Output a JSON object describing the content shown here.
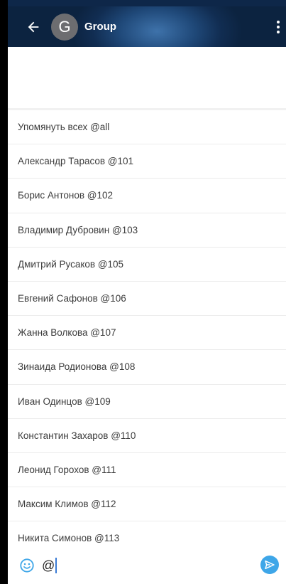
{
  "header": {
    "avatar_letter": "G",
    "title": "Group"
  },
  "mentions": [
    {
      "label": "Упомянуть всех @all"
    },
    {
      "label": "Александр Тарасов @101"
    },
    {
      "label": "Борис Антонов @102"
    },
    {
      "label": "Владимир Дубровин @103"
    },
    {
      "label": "Дмитрий Русаков @105"
    },
    {
      "label": "Евгений Сафонов @106"
    },
    {
      "label": "Жанна Волкова @107"
    },
    {
      "label": "Зинаида Родионова @108"
    },
    {
      "label": "Иван Одинцов @109"
    },
    {
      "label": "Константин Захаров @110"
    },
    {
      "label": "Леонид Горохов @111"
    },
    {
      "label": "Максим Климов @112"
    },
    {
      "label": "Никита Симонов @113"
    }
  ],
  "composer": {
    "text": "@"
  },
  "colors": {
    "accent": "#3ea6e8",
    "header_dark": "#0c2340",
    "avatar_bg": "#6d6d70"
  },
  "icons": {
    "back": "arrow-left-icon",
    "menu": "more-vertical-icon",
    "emoji": "smiley-icon",
    "send": "send-icon"
  }
}
